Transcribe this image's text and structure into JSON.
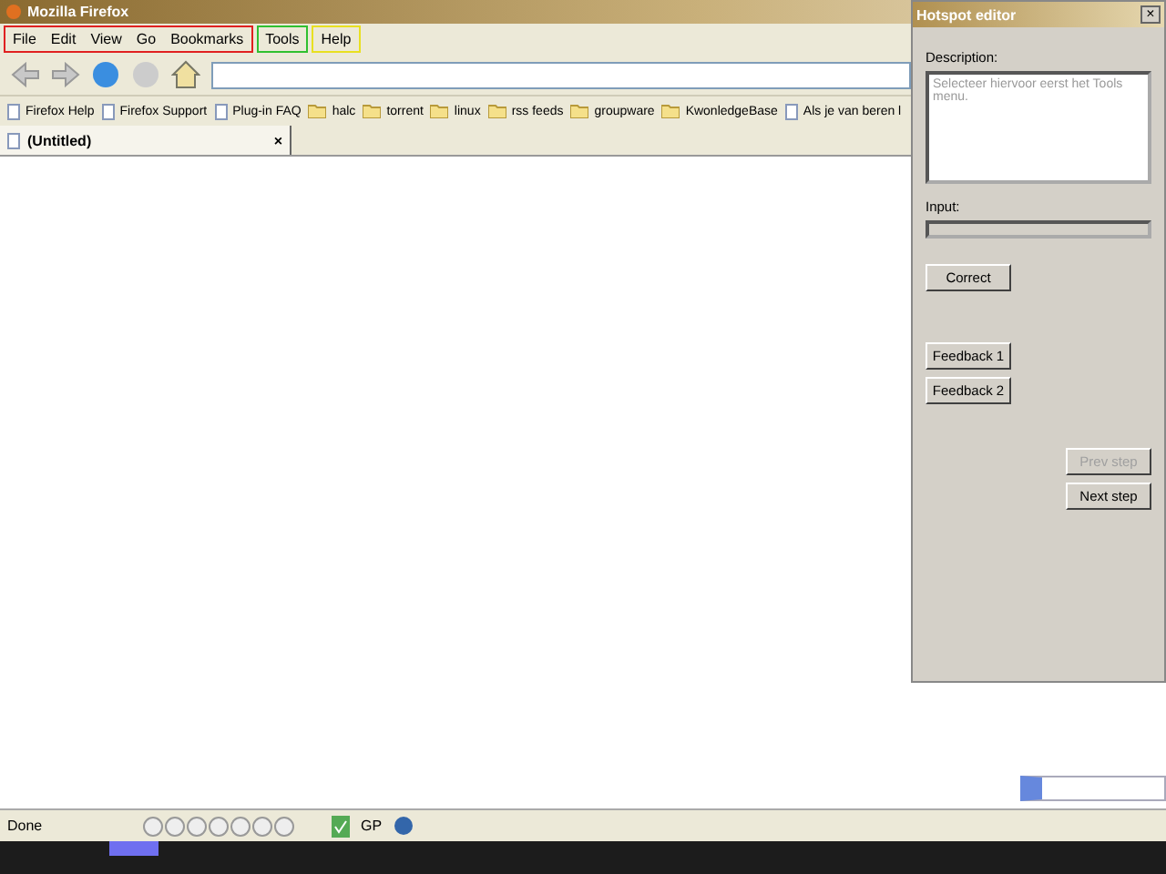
{
  "window": {
    "title": "Mozilla Firefox"
  },
  "menu_groups": [
    {
      "color": "#e02020",
      "items": [
        "File",
        "Edit",
        "View",
        "Go",
        "Bookmarks"
      ]
    },
    {
      "color": "#30c030",
      "items": [
        "Tools"
      ]
    },
    {
      "color": "#e8e020",
      "items": [
        "Help"
      ]
    }
  ],
  "bookmarks": [
    {
      "kind": "page",
      "label": "Firefox Help"
    },
    {
      "kind": "page",
      "label": "Firefox Support"
    },
    {
      "kind": "page",
      "label": "Plug-in FAQ"
    },
    {
      "kind": "folder",
      "label": "halc"
    },
    {
      "kind": "folder",
      "label": "torrent"
    },
    {
      "kind": "folder",
      "label": "linux"
    },
    {
      "kind": "folder",
      "label": "rss feeds"
    },
    {
      "kind": "folder",
      "label": "groupware"
    },
    {
      "kind": "folder",
      "label": "KwonledgeBase"
    },
    {
      "kind": "page",
      "label": "Als je van beren l"
    }
  ],
  "tabs": [
    {
      "label": "(Untitled)",
      "selected": true,
      "close": "×"
    }
  ],
  "status_bar": {
    "text": "Done",
    "gp": "GP"
  },
  "hotspot_editor": {
    "title": "Hotspot editor",
    "close": "×",
    "description_label": "Description:",
    "description": "Selecteer hiervoor eerst het Tools menu.",
    "input_label": "Input:",
    "buttons": [
      {
        "label": "Correct",
        "disabled": false
      },
      {
        "label": "Feedback 1",
        "disabled": false
      },
      {
        "label": "Feedback 2",
        "disabled": false
      },
      {
        "label": "Prev step",
        "disabled": true
      },
      {
        "label": "Next step",
        "disabled": false
      }
    ]
  }
}
